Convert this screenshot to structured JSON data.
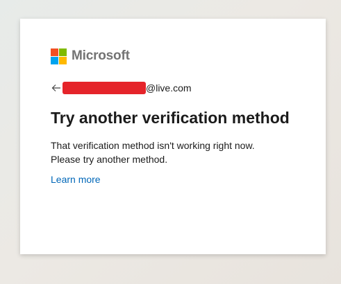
{
  "brand": {
    "name": "Microsoft",
    "logo_colors": [
      "#f25022",
      "#7fba00",
      "#00a4ef",
      "#ffb900"
    ]
  },
  "identity": {
    "back_icon": "arrow-left-icon",
    "email_suffix": "@live.com",
    "redaction_color": "#e5242a"
  },
  "dialog": {
    "title": "Try another verification method",
    "message_line1": "That verification method isn't working right now.",
    "message_line2": "Please try another method.",
    "learn_more_label": "Learn more"
  },
  "colors": {
    "link": "#0067b8",
    "text": "#1b1b1b"
  }
}
